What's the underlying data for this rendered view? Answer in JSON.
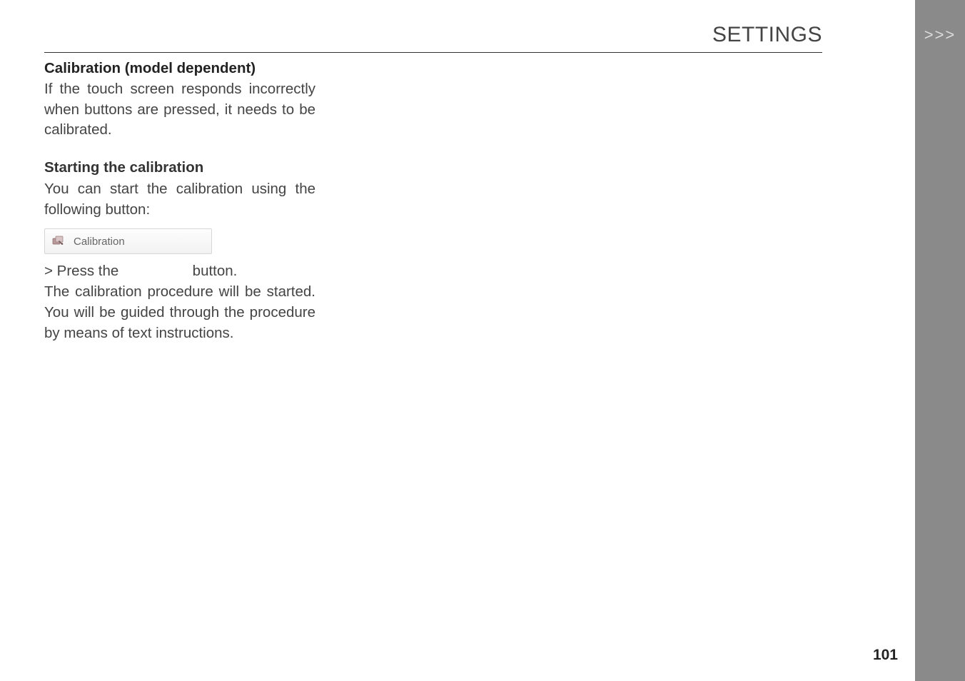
{
  "header": {
    "title": "SETTINGS",
    "chevrons": ">>>"
  },
  "content": {
    "section_title": "Calibration (model dependent)",
    "intro": "If the touch screen responds incorrectly when buttons are pressed, it needs to be calibrated.",
    "subheading": "Starting the calibration",
    "sub_intro": "You can start the calibration using the following button:",
    "button_label": "Calibration",
    "instruction_prefix": "> Press the ",
    "instruction_suffix": " button.",
    "result": "The calibration procedure will be started. You will be guided through the procedure by means of text instructions."
  },
  "footer": {
    "page_number": "101"
  }
}
